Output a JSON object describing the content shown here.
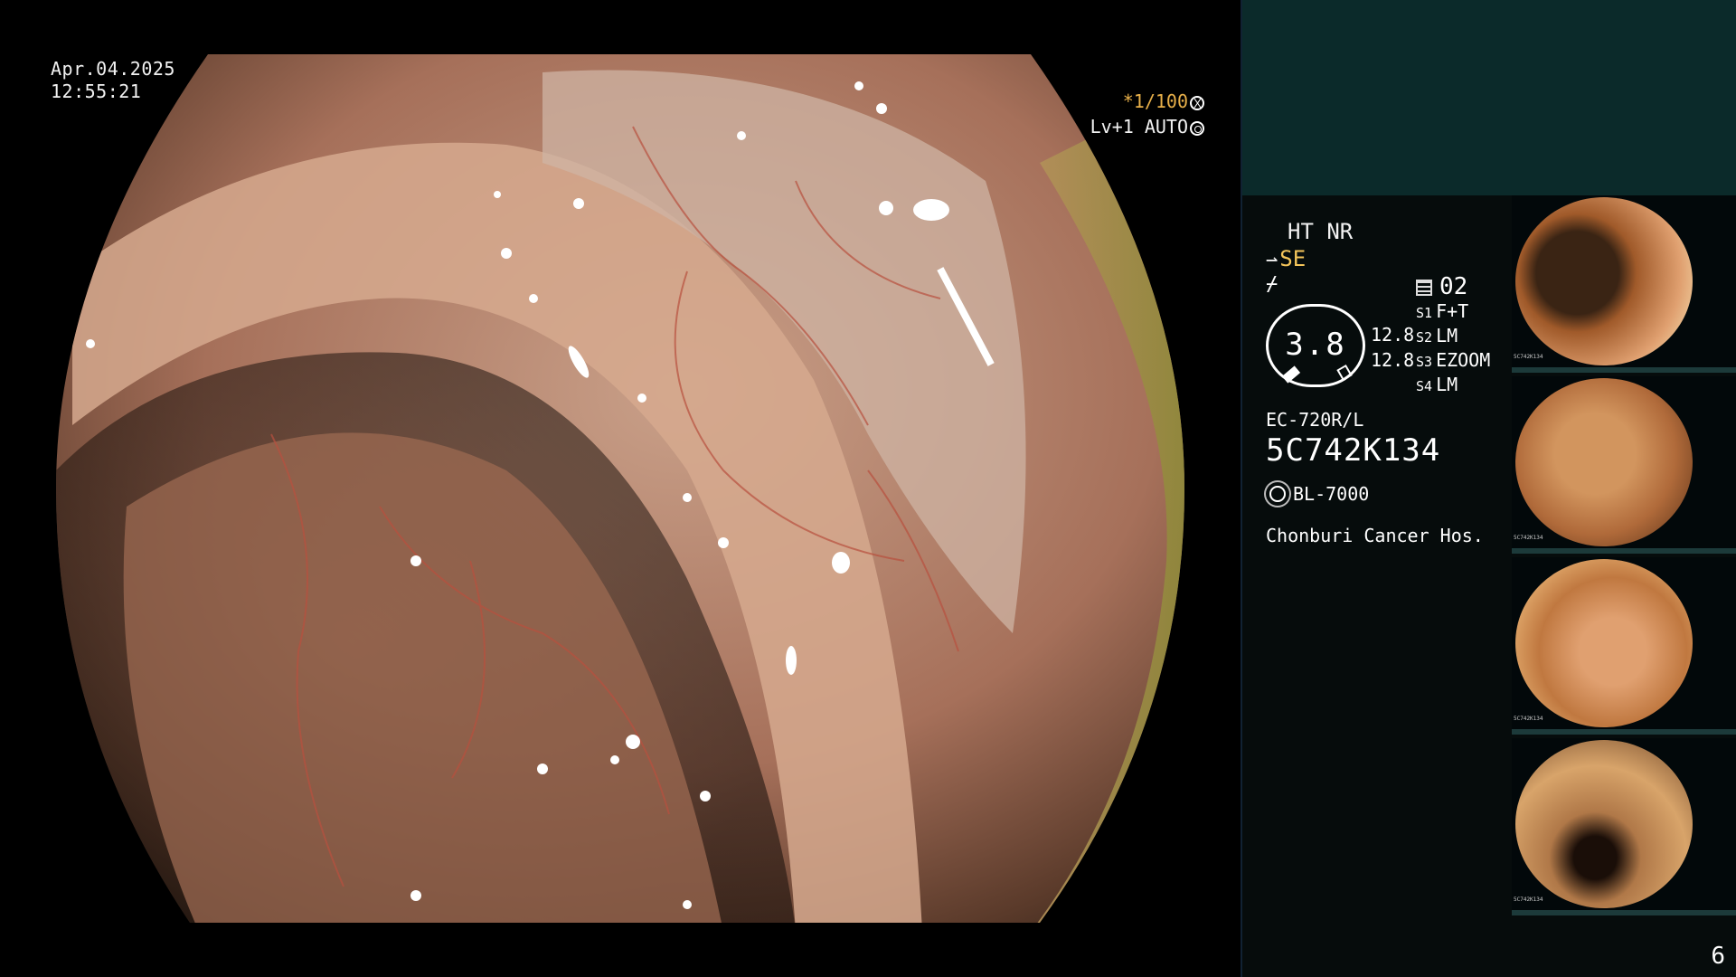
{
  "overlay": {
    "date": "Apr.04.2025",
    "time": "12:55:21",
    "shutter": "*1/100",
    "auto_level": "Lv+1 AUTO"
  },
  "panel": {
    "ht_nr": "HT NR",
    "se": "SE",
    "mode_number": "02",
    "gauge_value": "3.8",
    "gauge_readings": [
      "12.8",
      "12.8"
    ],
    "slots": [
      {
        "key": "S1",
        "value": "F+T"
      },
      {
        "key": "S2",
        "value": "LM"
      },
      {
        "key": "S3",
        "value": "EZOOM"
      },
      {
        "key": "S4",
        "value": "LM"
      }
    ],
    "scope_model": "EC-720R/L",
    "serial": "5C742K134",
    "light_source": "BL-7000",
    "hospital": "Chonburi Cancer Hos.",
    "page_number": "6"
  },
  "thumbnails": [
    {
      "id": "thumb-1",
      "serial": "5C742K134"
    },
    {
      "id": "thumb-2",
      "serial": "5C742K134"
    },
    {
      "id": "thumb-3",
      "serial": "5C742K134"
    },
    {
      "id": "thumb-4",
      "serial": "5C742K134"
    }
  ],
  "colors": {
    "mucosa": "#c98a6a",
    "panel_bg": "#060c0c",
    "panel_header": "#0b2a2a",
    "accent": "#f4c55a"
  }
}
